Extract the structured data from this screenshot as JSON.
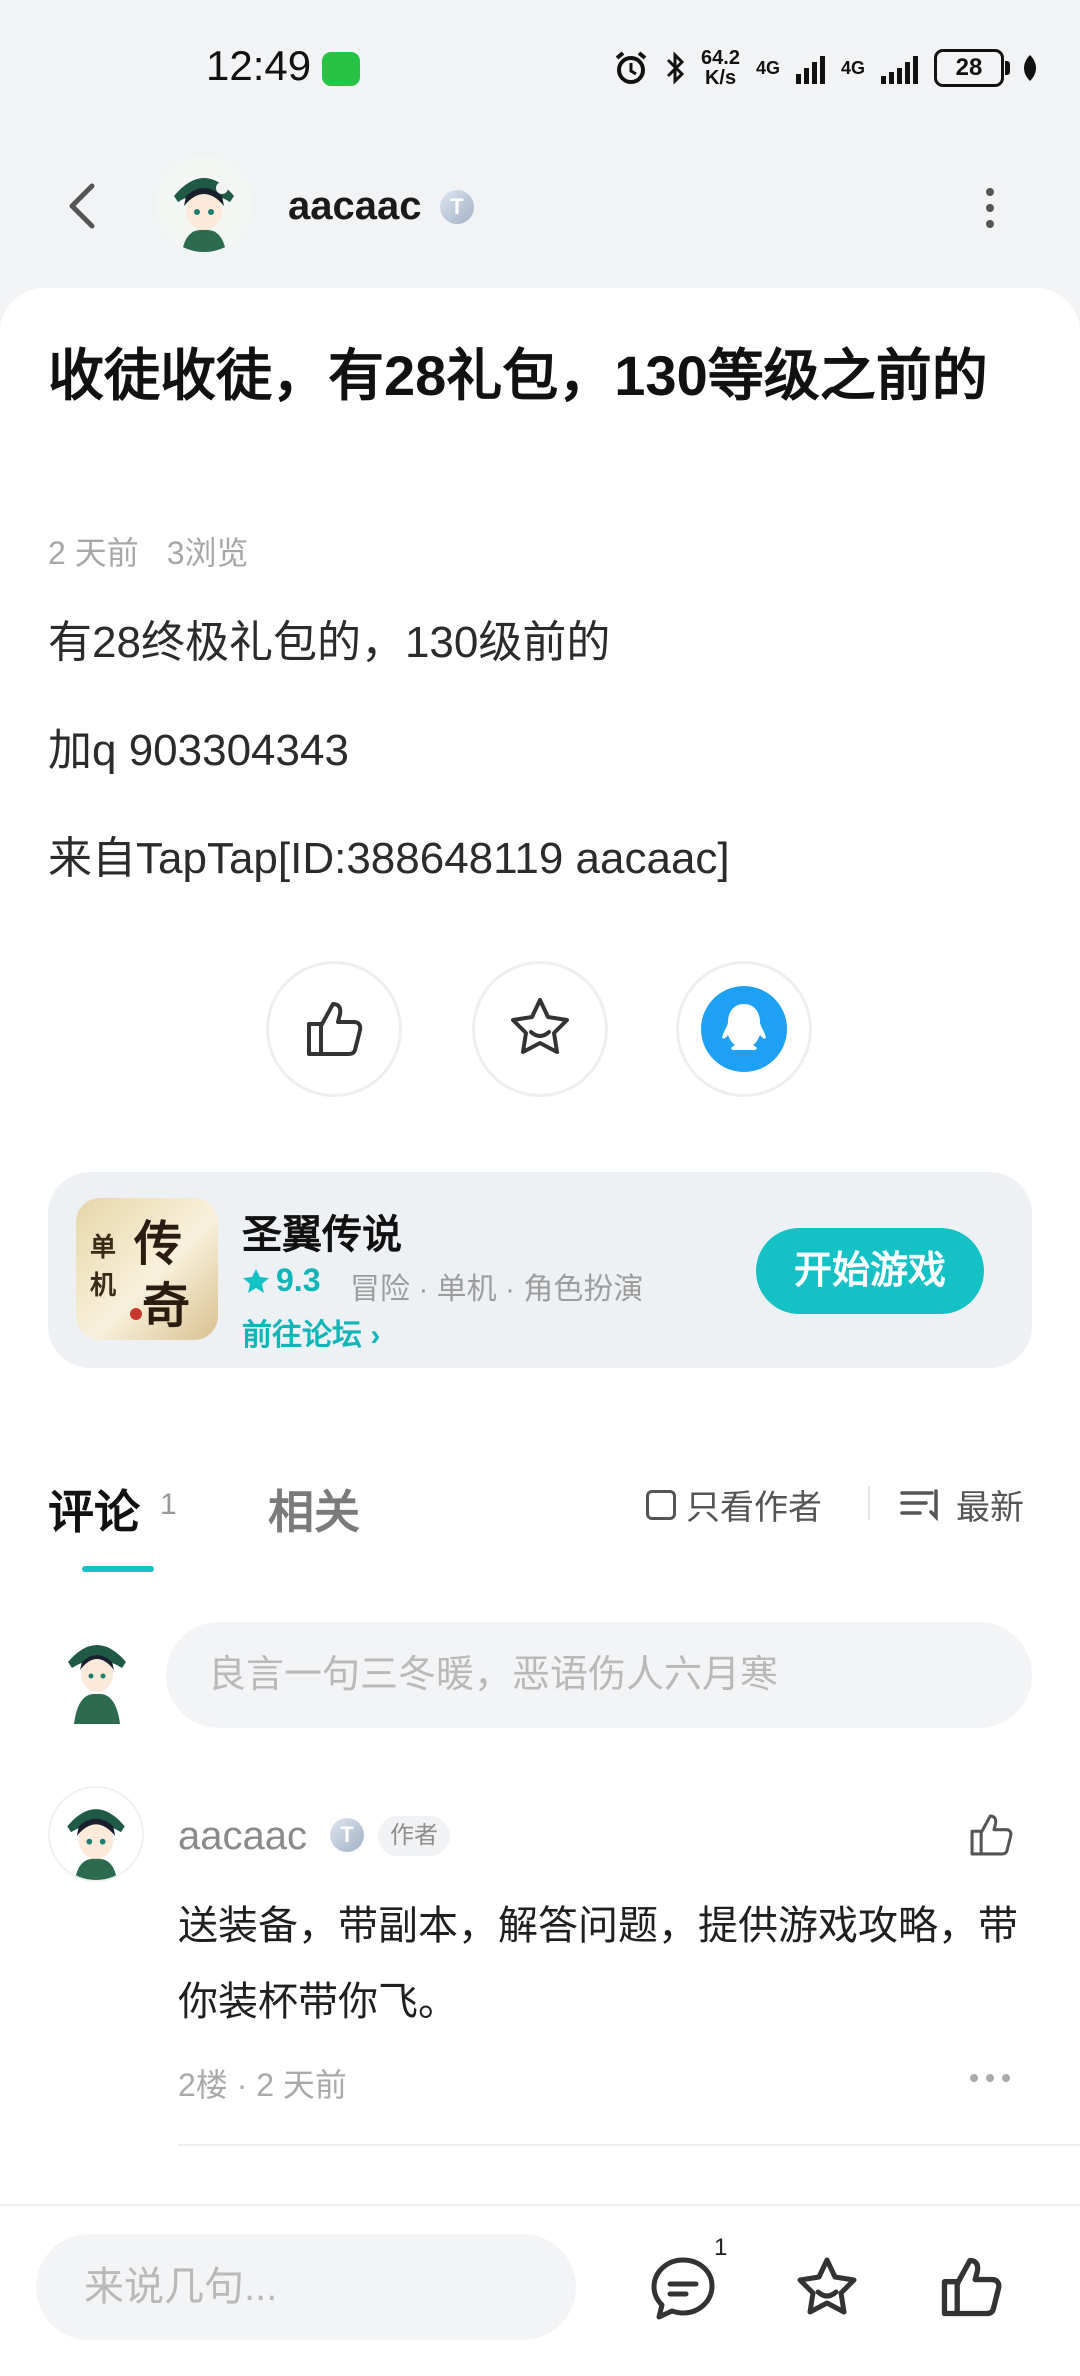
{
  "status_bar": {
    "time": "12:49",
    "net_speed_value": "64.2",
    "net_speed_unit": "K/s",
    "signal1": "4G",
    "signal2": "4G",
    "battery": "28"
  },
  "header": {
    "username": "aacaac",
    "badge": "T"
  },
  "post": {
    "title": "收徒收徒，有28礼包，130等级之前的",
    "time_ago": "2 天前",
    "views": "3浏览",
    "lines": [
      "有28终极礼包的，130级前的",
      "加q  903304343",
      "来自TapTap[ID:388648119 aacaac]"
    ]
  },
  "game": {
    "name": "圣翼传说",
    "rating": "9.3",
    "tags": "冒险 · 单机 · 角色扮演",
    "forum_link": "前往论坛 ›",
    "play_button": "开始游戏",
    "icon_text": "单机 传奇"
  },
  "comments_section": {
    "tab_comments": "评论",
    "comment_count": "1",
    "tab_related": "相关",
    "author_only": "只看作者",
    "sort": "最新",
    "input_placeholder": "良言一句三冬暖，恶语伤人六月寒"
  },
  "comment": {
    "username": "aacaac",
    "badge": "T",
    "author_tag": "作者",
    "text": "送装备，带副本，解答问题，提供游戏攻略，带你装杯带你飞。",
    "floor": "2楼 · 2 天前"
  },
  "bottom_bar": {
    "placeholder": "来说几句...",
    "comment_badge": "1"
  },
  "colors": {
    "accent": "#14c1c4",
    "qq": "#1ea0f5"
  }
}
